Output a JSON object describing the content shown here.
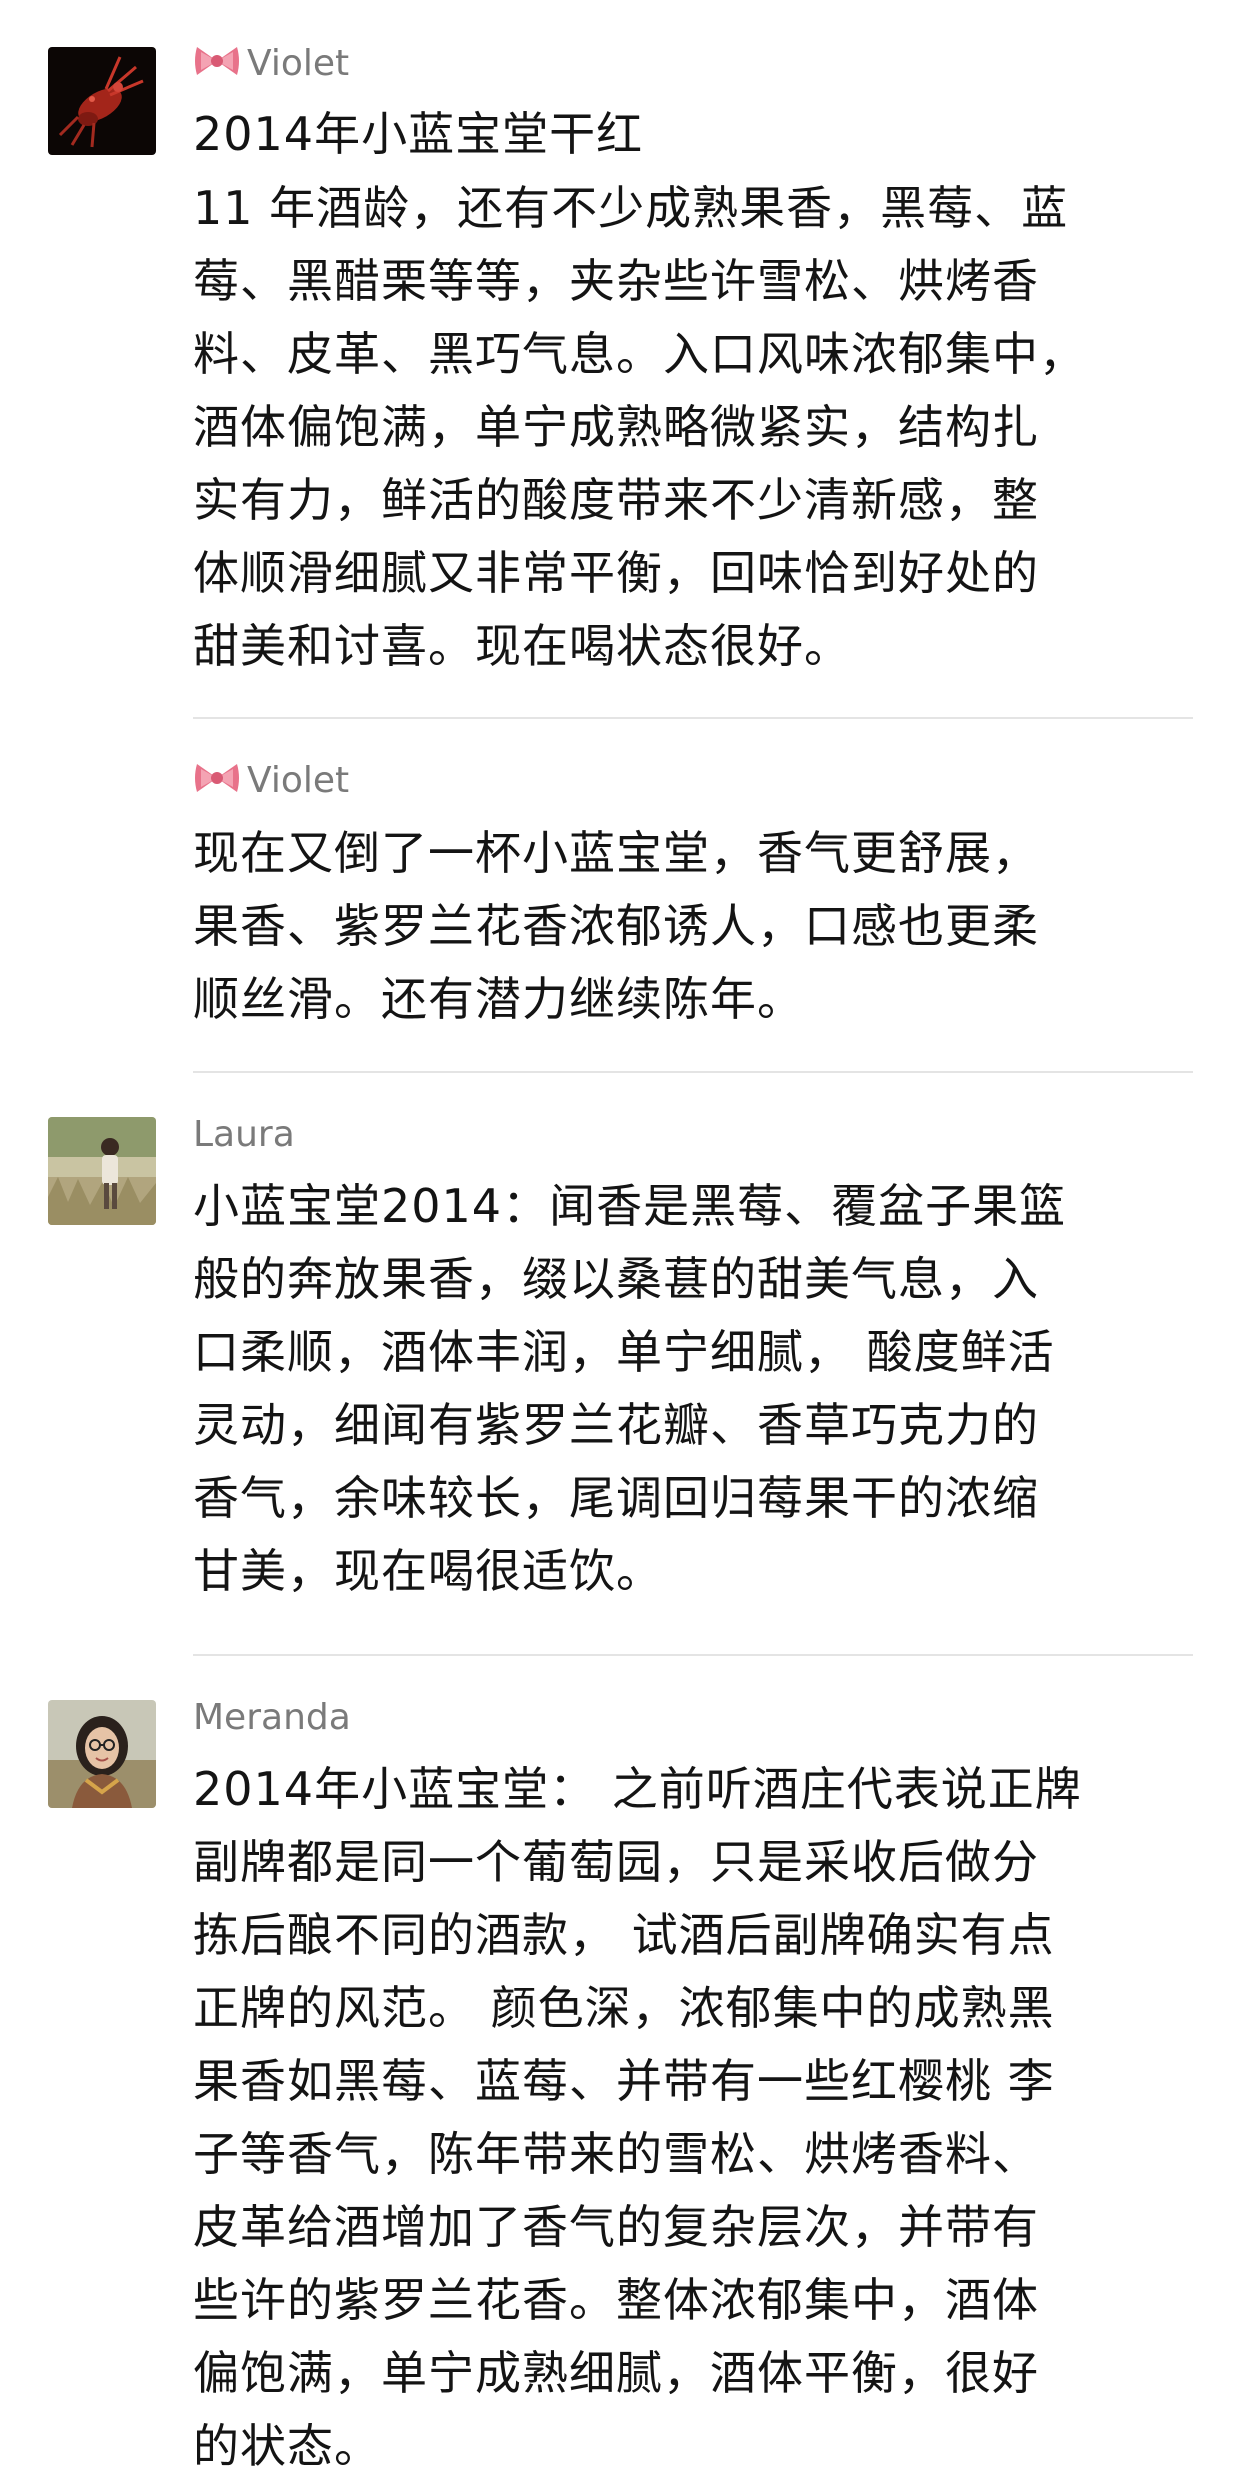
{
  "posts": [
    {
      "author": "Violet",
      "author_prefix_icon": "ribbon-bow-icon",
      "avatar": "red-lobster-avatar",
      "lines": [
        "2014年小蓝宝堂干红",
        "11 年酒龄，还有不少成熟果香，黑莓、蓝",
        "莓、黑醋栗等等，夹杂些许雪松、烘烤香",
        "料、皮革、黑巧气息。入口风味浓郁集中，",
        "酒体偏饱满，单宁成熟略微紧实，结构扎",
        "实有力，鲜活的酸度带来不少清新感，整",
        "体顺滑细腻又非常平衡，回味恰到好处的",
        "甜美和讨喜。现在喝状态很好。"
      ]
    },
    {
      "author": "Violet",
      "author_prefix_icon": "ribbon-bow-icon",
      "lines": [
        "现在又倒了一杯小蓝宝堂，香气更舒展，",
        "果香、紫罗兰花香浓郁诱人，口感也更柔",
        "顺丝滑。还有潜力继续陈年。"
      ]
    },
    {
      "author": "Laura",
      "avatar": "outdoor-grass-avatar",
      "lines": [
        "小蓝宝堂2014：闻香是黑莓、覆盆子果篮",
        "般的奔放果香，缀以桑葚的甜美气息，入",
        "口柔顺，酒体丰润，单宁细腻， 酸度鲜活",
        "灵动，细闻有紫罗兰花瓣、香草巧克力的",
        "香气，余味较长，尾调回归莓果干的浓缩",
        "甘美，现在喝很适饮。"
      ]
    },
    {
      "author": "Meranda",
      "avatar": "woman-glasses-avatar",
      "lines": [
        "2014年小蓝宝堂：  之前听酒庄代表说正牌",
        "副牌都是同一个葡萄园，只是采收后做分",
        "拣后酿不同的酒款， 试酒后副牌确实有点",
        "正牌的风范。 颜色深，浓郁集中的成熟黑",
        "果香如黑莓、蓝莓、并带有一些红樱桃 李",
        "子等香气，陈年带来的雪松、烘烤香料、",
        "皮革给酒增加了香气的复杂层次，并带有",
        "些许的紫罗兰花香。整体浓郁集中，酒体",
        "偏饱满，单宁成熟细腻，酒体平衡，很好",
        "的状态。"
      ]
    }
  ],
  "colors": {
    "background": "#ffffff",
    "author_name": "#7a7a7a",
    "body_text": "#141414",
    "divider": "#e4e4e4",
    "bow": "#e8728a"
  }
}
